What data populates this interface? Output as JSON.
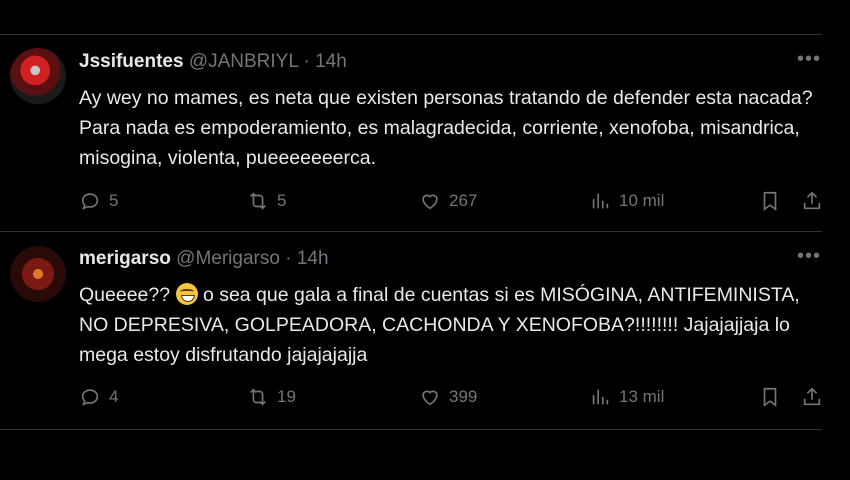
{
  "tweets": [
    {
      "name": "Jssifuentes",
      "handle": "@JANBRIYL",
      "separator": "·",
      "time": "14h",
      "text": "Ay wey no mames, es neta que existen personas tratando de defender esta nacada? Para nada es empoderamiento, es malagradecida, corriente, xenofoba, misandrica, misogina, violenta, pueeeeeeerca.",
      "replies": "5",
      "retweets": "5",
      "likes": "267",
      "views": "10 mil"
    },
    {
      "name": "merigarso",
      "handle": "@Merigarso",
      "separator": "·",
      "time": "14h",
      "text_before_emoji": "Queeee??",
      "text_after_emoji": "o sea que gala a final de cuentas si es MISÓGINA, ANTIFEMINISTA, NO DEPRESIVA, GOLPEADORA, CACHONDA Y XENOFOBA?!!!!!!!! Jajajajjaja lo mega estoy disfrutando jajajajajja",
      "emoji": "grinning-face-emoji",
      "replies": "4",
      "retweets": "19",
      "likes": "399",
      "views": "13 mil"
    }
  ],
  "icons": {
    "more": "more-icon",
    "reply": "reply-icon",
    "retweet": "retweet-icon",
    "like": "heart-icon",
    "views": "views-icon",
    "bookmark": "bookmark-icon",
    "share": "share-icon"
  },
  "colors": {
    "background": "#000000",
    "text": "#e7e9ea",
    "muted": "#71767b",
    "divider": "#2f3336"
  }
}
